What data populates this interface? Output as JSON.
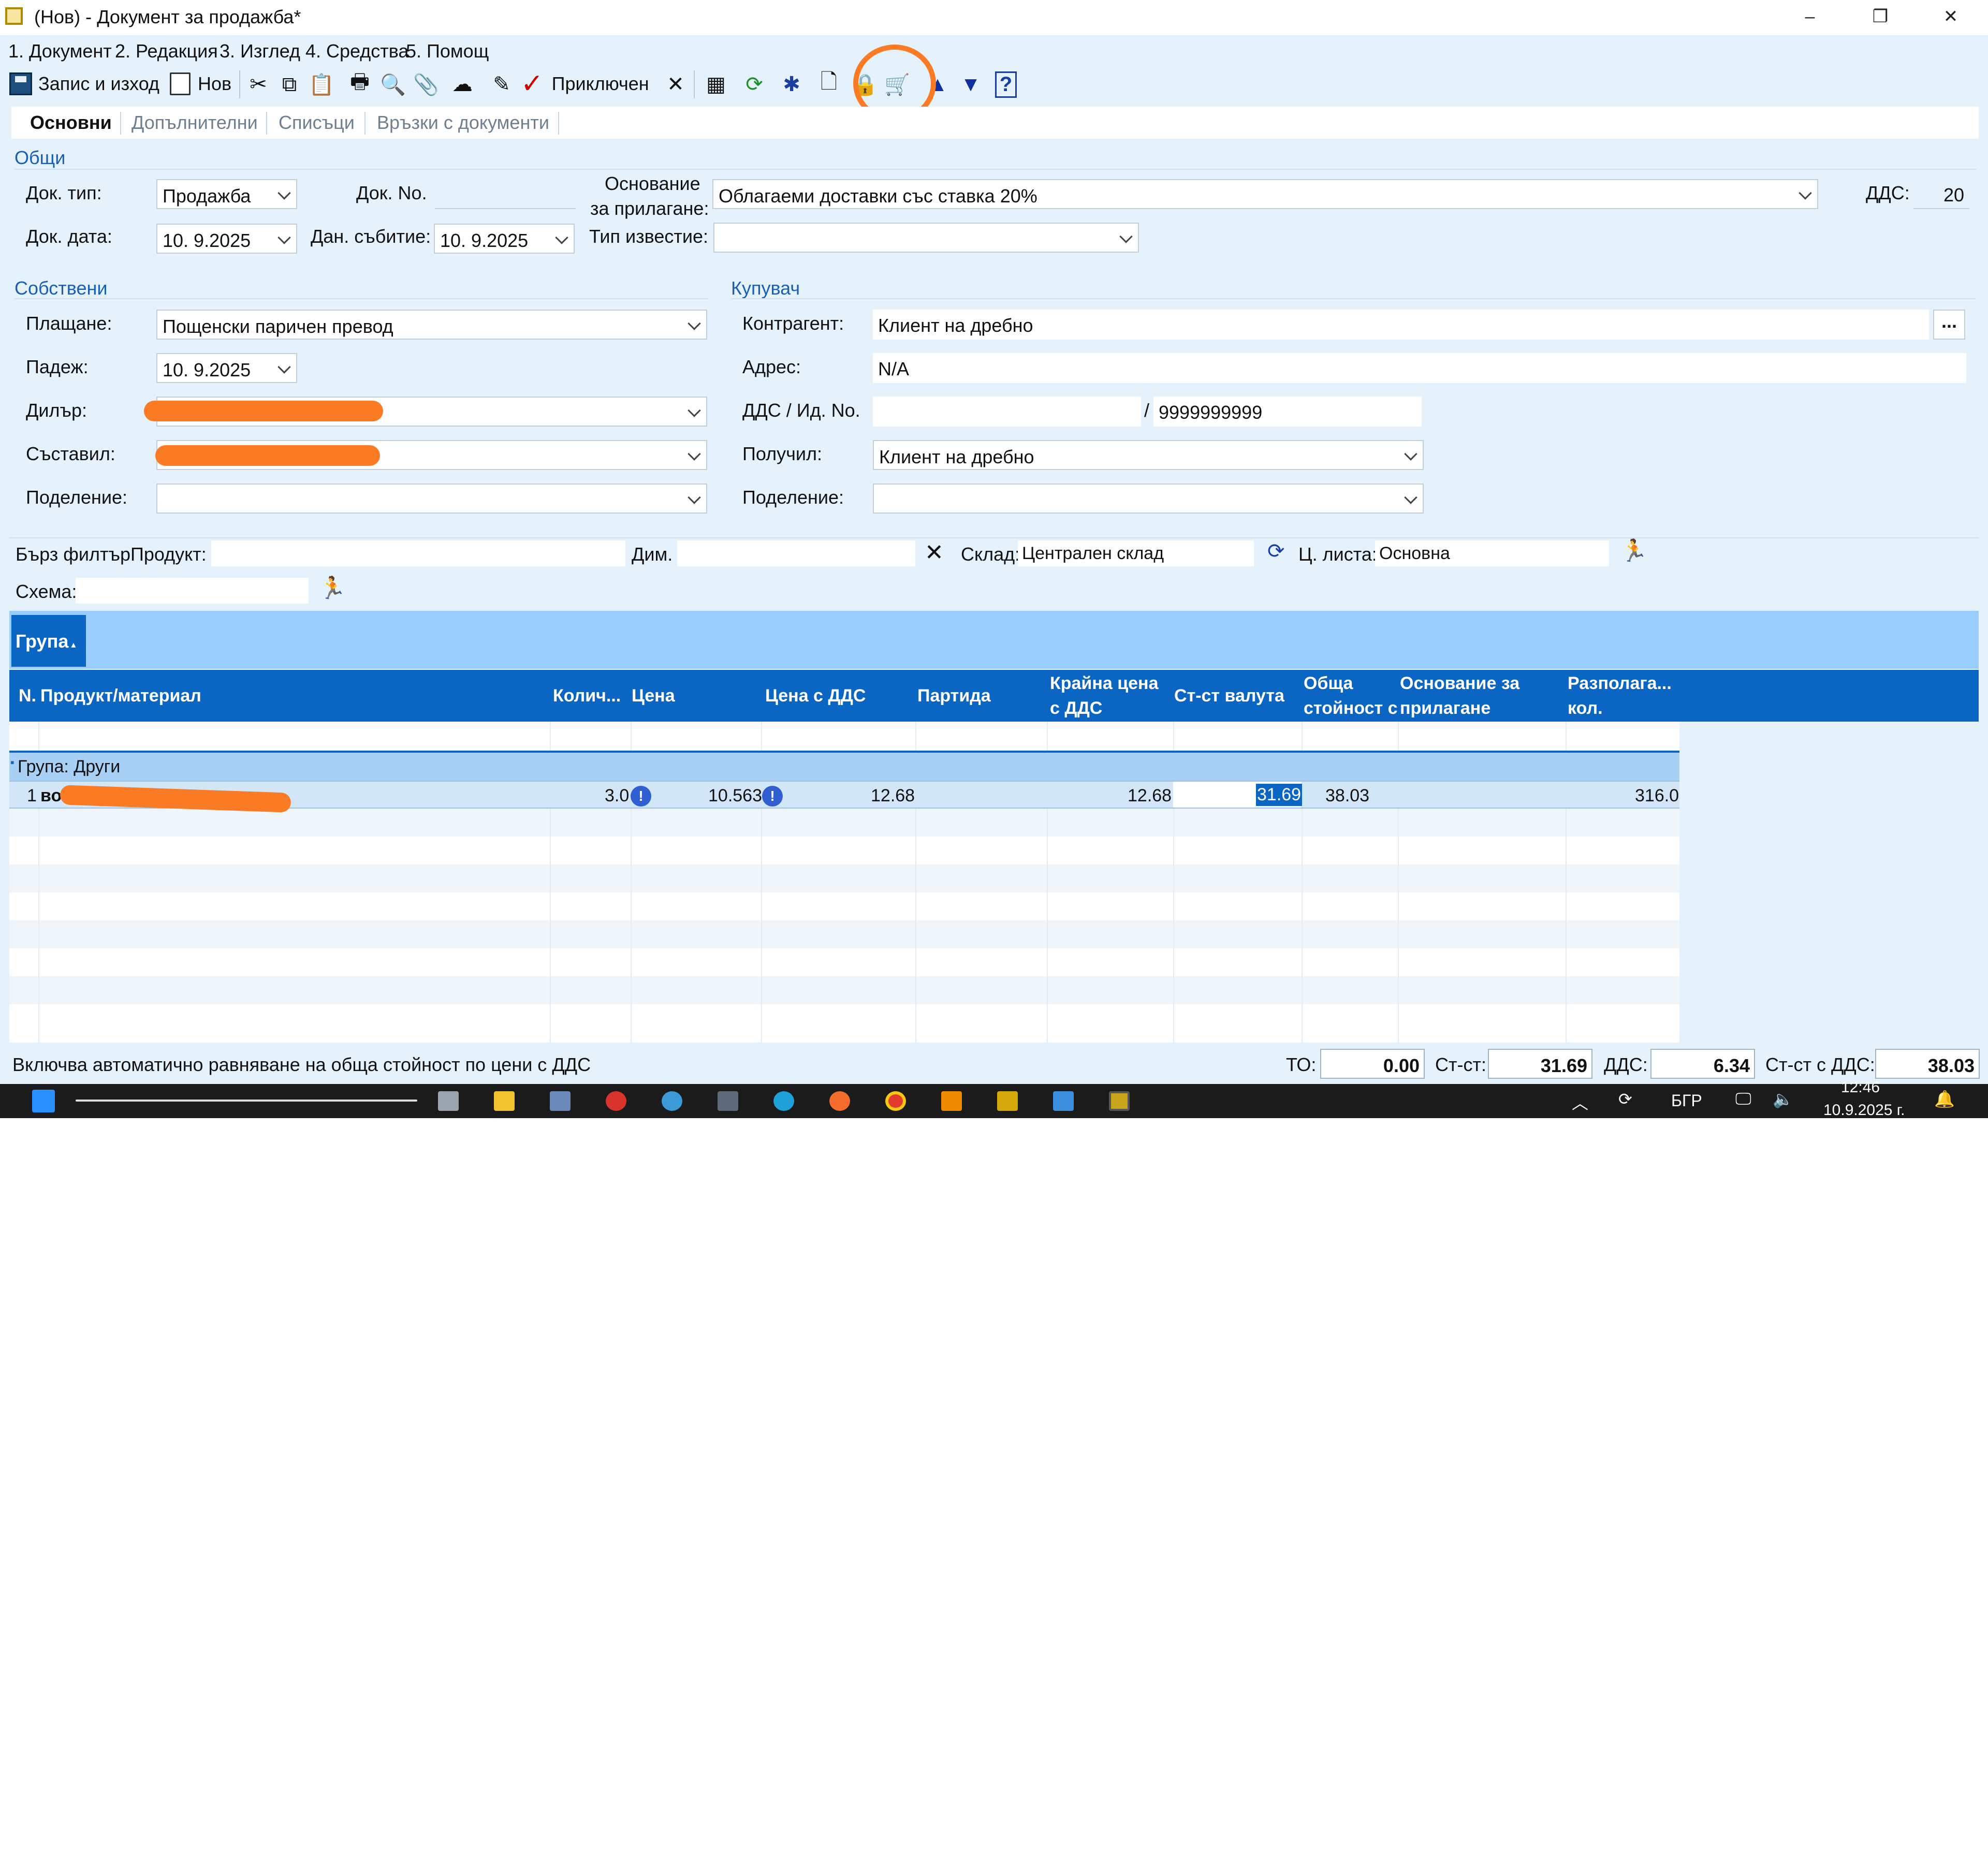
{
  "window": {
    "title": "(Нов) - Документ за продажба*",
    "minimize": "–",
    "restore": "❐",
    "close": "✕"
  },
  "menu": [
    "1. Документ",
    "2. Редакция",
    "3. Изглед",
    "4. Средства",
    "5. Помощ"
  ],
  "toolbar": {
    "save_exit": "Запис и изход",
    "new": "Нов",
    "completed": "Приключен"
  },
  "tabs": [
    "Основни",
    "Допълнителни",
    "Списъци",
    "Връзки с документи"
  ],
  "general": {
    "section": "Общи",
    "doc_type_label": "Док. тип:",
    "doc_type_value": "Продажба",
    "doc_no_label": "Док. No.",
    "doc_no_value": "",
    "basis_label_1": "Основание",
    "basis_label_2": "за прилагане:",
    "basis_value": "Облагаеми доставки със ставка 20%",
    "vat_label": "ДДС:",
    "vat_value": "20",
    "doc_date_label": "Док. дата:",
    "doc_date_value": "10.  9.2025",
    "tax_event_label": "Дан. събитие:",
    "tax_event_value": "10.  9.2025",
    "notice_type_label": "Тип известие:",
    "notice_type_value": ""
  },
  "own": {
    "section": "Собствени",
    "payment_label": "Плащане:",
    "payment_value": "Пощенски паричен превод",
    "due_label": "Падеж:",
    "due_value": "10.  9.2025",
    "dealer_label": "Дилър:",
    "composer_label": "Съставил:",
    "division_label": "Поделение:",
    "division_value": ""
  },
  "buyer": {
    "section": "Купувач",
    "counterparty_label": "Контрагент:",
    "counterparty_value": "Клиент на дребно",
    "more_button": "...",
    "address_label": "Адрес:",
    "address_value": "N/A",
    "vat_id_label": "ДДС / Ид. No.",
    "vat_no_value": "",
    "id_sep": "/",
    "id_no_value": "9999999999",
    "receiver_label": "Получил:",
    "receiver_value": "Клиент на дребно",
    "division_label": "Поделение:",
    "division_value": ""
  },
  "filter": {
    "quick_filter_label": "Бърз филтър",
    "product_label": "Продукт:",
    "product_value": "",
    "dim_label": "Дим.",
    "dim_value": "",
    "warehouse_label": "Склад:",
    "warehouse_value": "Централен склад",
    "price_list_label": "Ц. листа:",
    "price_list_value": "Основна",
    "scheme_label": "Схема:",
    "scheme_value": ""
  },
  "grid": {
    "group_chip": "Група",
    "columns": {
      "n": "N.",
      "product": "Продукт/материал",
      "qty": "Колич...",
      "price": "Цена",
      "price_vat": "Цена с ДДС",
      "batch": "Партида",
      "final_price_1": "Крайна цена",
      "final_price_2": "с ДДС",
      "cur_value": "Ст-ст валута",
      "total_1": "Обща",
      "total_2": "стойност с",
      "basis_1": "Основание за",
      "basis_2": "прилагане",
      "available_1": "Разполага...",
      "available_2": "кол."
    },
    "group_row": "Група: Други",
    "row": {
      "n": "1",
      "product_prefix": "во",
      "product_suffix": "...",
      "qty": "3.0",
      "price": "10.563",
      "price_vat": "12.68",
      "batch": "",
      "final_price": "12.68",
      "cur_value": "",
      "value": "31.69",
      "total": "38.03",
      "basis": "",
      "available": "316.0"
    }
  },
  "status": {
    "note": "Включва автоматично равняване на обща стойност по цени с ДДС",
    "to_label": "ТО:",
    "to_value": "0.00",
    "cost_label": "Ст-ст:",
    "cost_value": "31.69",
    "vat_label": "ДДС:",
    "vat_value": "6.34",
    "total_label": "Ст-ст с ДДС:",
    "total_value": "38.03"
  },
  "taskbar": {
    "language": "БГР",
    "time": "12:46",
    "date": "10.9.2025 г."
  },
  "colors": {
    "accent": "#0a66c2",
    "group_band": "#99ccff",
    "annotation": "#fb7a24",
    "app_background": "#e6f2fb"
  },
  "icons": [
    "save-icon",
    "new-document-icon",
    "cut-icon",
    "copy-icon",
    "paste-icon",
    "print-icon",
    "preview-icon",
    "attach-icon",
    "cloud-icon",
    "edit-icon",
    "checkmark-icon",
    "delete-icon",
    "calendar-icon",
    "refresh-icon",
    "star-icon",
    "page-icon",
    "lock-icon",
    "cart-icon",
    "arrow-up-icon",
    "arrow-down-icon",
    "help-icon"
  ]
}
